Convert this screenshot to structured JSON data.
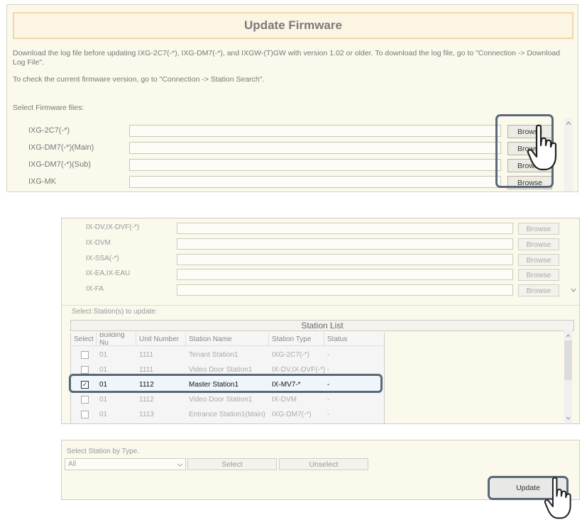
{
  "firmware": {
    "title": "Update Firmware",
    "note1": "Download the log file before updating IXG-2C7(-*), IXG-DM7(-*), and IXGW-(T)GW with version 1.02 or older. To download the log file, go to \"Connection -> Download Log File\".",
    "note2": "To check the current firmware version, go to \"Connection -> Station Search\".",
    "select_label": "Select Firmware files:",
    "rows": [
      {
        "label": "IXG-2C7(-*)",
        "button": "Browse"
      },
      {
        "label": "IXG-DM7(-*)(Main)",
        "button": "Browse"
      },
      {
        "label": "IXG-DM7(-*)(Sub)",
        "button": "Browse"
      },
      {
        "label": "IXG-MK",
        "button": "Browse"
      }
    ]
  },
  "firmware2": {
    "rows": [
      {
        "label": "IX-DV,IX-DVF(-*)",
        "button": "Browse"
      },
      {
        "label": "IX-DVM",
        "button": "Browse"
      },
      {
        "label": "IX-SSA(-*)",
        "button": "Browse"
      },
      {
        "label": "IX-EA,IX-EAU",
        "button": "Browse"
      },
      {
        "label": "IX-FA",
        "button": "Browse"
      }
    ],
    "select_stations_label": "Select Station(s) to update:",
    "station_list_title": "Station List",
    "columns": [
      "Select",
      "Building Nu",
      "Unit Number",
      "Station Name",
      "Station Type",
      "Status"
    ],
    "stations": [
      {
        "building": "01",
        "unit": "1111",
        "name": "Tenant Station1",
        "type": "IXG-2C7(-*)",
        "status": "-",
        "checked": false
      },
      {
        "building": "01",
        "unit": "1111",
        "name": "Video Door Station1",
        "type": "IX-DV,IX-DVF(-*)",
        "status": "-",
        "checked": false
      },
      {
        "building": "01",
        "unit": "1112",
        "name": "Master Station1",
        "type": "IX-MV7-*",
        "status": "-",
        "checked": true
      },
      {
        "building": "01",
        "unit": "1112",
        "name": "Video Door Station1",
        "type": "IX-DVM",
        "status": "-",
        "checked": false
      },
      {
        "building": "01",
        "unit": "1113",
        "name": "Entrance Station1(Main)",
        "type": "IXG-DM7(-*)",
        "status": "-",
        "checked": false
      }
    ],
    "check_mark": "✓"
  },
  "bytype": {
    "label": "Select Station by Type.",
    "dropdown_value": "All",
    "select_button": "Select",
    "unselect_button": "Unselect",
    "update_button": "Update"
  },
  "colors": {
    "panel_bg": "#fbf8ec",
    "title_border": "#f3d7a8",
    "highlight_border": "#5a6778"
  },
  "icons": {
    "pointer": "hand-pointer-icon",
    "scroll_up": "chevron-up-icon",
    "scroll_down": "chevron-down-icon",
    "dropdown": "chevron-down-icon"
  }
}
